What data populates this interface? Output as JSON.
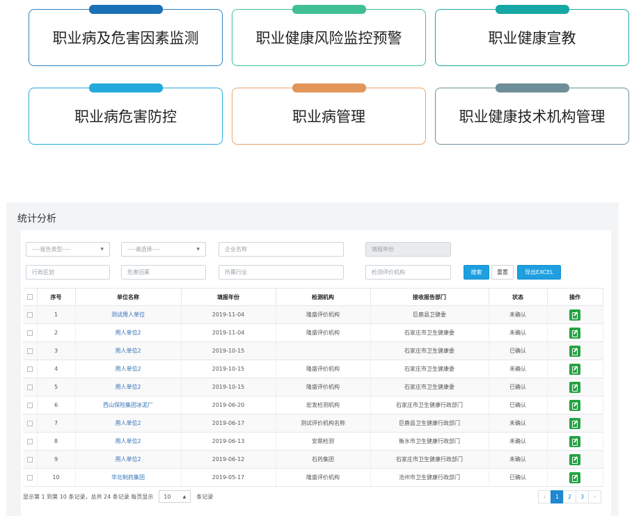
{
  "modules": [
    {
      "label": "职业病及危害因素监测",
      "color": "#2a7fc2",
      "tab_color": "#1c70b6"
    },
    {
      "label": "职业健康风险监控预警",
      "color": "#3fbf93",
      "tab_color": "#3fbf93"
    },
    {
      "label": "职业健康宣教",
      "color": "#17a7a4",
      "tab_color": "#17a7a4"
    },
    {
      "label": "职业病危害防控",
      "color": "#25a9dc",
      "tab_color": "#25a9dc"
    },
    {
      "label": "职业病管理",
      "color": "#e8a26a",
      "tab_color": "#e3965a"
    },
    {
      "label": "职业健康技术机构管理",
      "color": "#6e8f99",
      "tab_color": "#6e8f99"
    }
  ],
  "stats": {
    "title": "统计分析",
    "filters": {
      "report_type": "----报告类型----",
      "select": "----请选择----",
      "company_placeholder": "企业名称",
      "report_year_placeholder": "填报年份",
      "region_placeholder": "行政区划",
      "hazard_placeholder": "危害因素",
      "industry_placeholder": "所属行业",
      "agency_placeholder": "检测评价机构"
    },
    "buttons": {
      "search": "搜索",
      "reset": "重置",
      "export": "导出EXCEL"
    },
    "table": {
      "headers": [
        "序号",
        "单位名称",
        "填报年份",
        "检测机构",
        "接收报告部门",
        "状态",
        "操作"
      ],
      "rows": [
        [
          "1",
          "测试用人单位",
          "2019-11-04",
          "隆盛评价机构",
          "巨鹿县卫健委",
          "未确认"
        ],
        [
          "2",
          "用人单位2",
          "2019-11-04",
          "隆盛评价机构",
          "石家庄市卫生健康委",
          "未确认"
        ],
        [
          "3",
          "用人单位2",
          "2019-10-15",
          "",
          "石家庄市卫生健康委",
          "已确认"
        ],
        [
          "4",
          "用人单位2",
          "2019-10-15",
          "隆盛评价机构",
          "石家庄市卫生健康委",
          "未确认"
        ],
        [
          "5",
          "用人单位2",
          "2019-10-15",
          "隆盛评价机构",
          "石家庄市卫生健康委",
          "已确认"
        ],
        [
          "6",
          "西山保险集团冰泥厂",
          "2019-06-20",
          "宏发检测机构",
          "石家庄市卫生健康行政部门",
          "已确认"
        ],
        [
          "7",
          "用人单位2",
          "2019-06-17",
          "测试评价机构名称",
          "巨鹿县卫生健康行政部门",
          "未确认"
        ],
        [
          "8",
          "用人单位2",
          "2019-06-13",
          "安鼎检测",
          "衡水市卫生健康行政部门",
          "未确认"
        ],
        [
          "9",
          "用人单位2",
          "2019-06-12",
          "石药集团",
          "石家庄市卫生健康行政部门",
          "未确认"
        ],
        [
          "10",
          "华北制药集团",
          "2019-05-17",
          "隆盛评价机构",
          "沧州市卫生健康行政部门",
          "已确认"
        ]
      ]
    },
    "footer": {
      "summary": "显示第 1 到第 10 条记录，总共 24 条记录 每页显示",
      "per_page": "10",
      "suffix": "条记录"
    },
    "pagination": {
      "prev": "‹",
      "pages": [
        "1",
        "2",
        "3"
      ],
      "next": "›",
      "current": "1"
    }
  }
}
